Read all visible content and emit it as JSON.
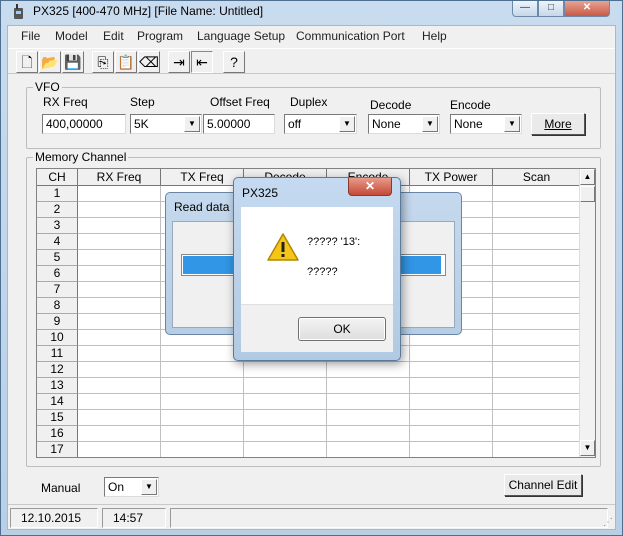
{
  "window": {
    "title": "PX325 [400-470 MHz] [File Name: Untitled]",
    "caption_min": "—",
    "caption_max": "□",
    "caption_close": "✕"
  },
  "menu": [
    "File",
    "Model",
    "Edit",
    "Program",
    "Language Setup",
    "Communication Port",
    "Help"
  ],
  "toolbar": {
    "icons": [
      "new-icon",
      "open-icon",
      "save-icon",
      "copy-icon",
      "paste-icon",
      "erase-icon",
      "read-radio-icon",
      "write-radio-icon",
      "help-icon"
    ],
    "glyphs": [
      "🗋",
      "📂",
      "💾",
      "⎘",
      "📋",
      "⌫",
      "⇥",
      "⇤",
      "?"
    ]
  },
  "vfo": {
    "legend": "VFO",
    "rx_freq_label": "RX Freq",
    "rx_freq_value": "400,00000",
    "step_label": "Step",
    "step_value": "5K",
    "offset_label": "Offset Freq",
    "offset_value": "5.00000",
    "duplex_label": "Duplex",
    "duplex_value": "off",
    "decode_label": "Decode",
    "decode_value": "None",
    "encode_label": "Encode",
    "encode_value": "None",
    "more_label": "More"
  },
  "memory": {
    "legend": "Memory Channel",
    "columns": [
      "CH",
      "RX Freq",
      "TX Freq",
      "Decode",
      "Encode",
      "TX Power",
      "Scan"
    ],
    "channels": [
      "1",
      "2",
      "3",
      "4",
      "5",
      "6",
      "7",
      "8",
      "9",
      "10",
      "11",
      "12",
      "13",
      "14",
      "15",
      "16",
      "17"
    ]
  },
  "bottom": {
    "mode_label": "Manual",
    "mode_value": "On",
    "channel_edit_label": "Channel Edit"
  },
  "status": {
    "date": "12.10.2015",
    "time": "14:57",
    "grip": "⋰"
  },
  "progress_dialog": {
    "title": "Read data f",
    "progress": 0.98
  },
  "message_box": {
    "title": "PX325",
    "close": "✕",
    "line1": "????? '13':",
    "line2": "?????",
    "ok_label": "OK"
  },
  "colors": {
    "titlebar": "#c9dcef",
    "progress": "#3296e6",
    "close_red": "#c44a36"
  }
}
